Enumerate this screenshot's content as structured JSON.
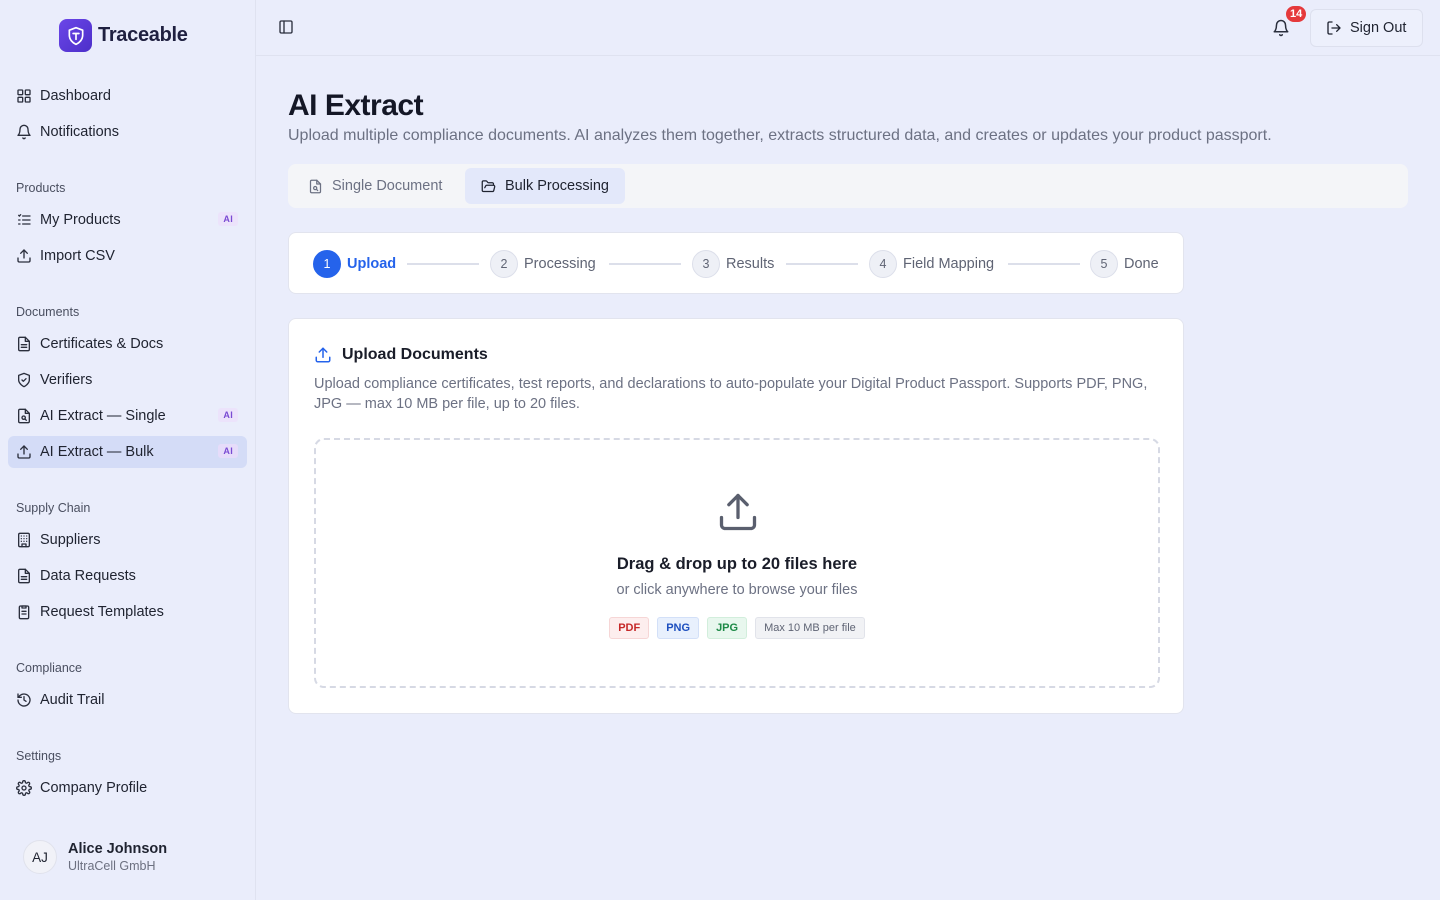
{
  "brand": {
    "name": "Traceable"
  },
  "sidebar": {
    "top_items": [
      {
        "label": "Dashboard",
        "icon": "grid-icon"
      },
      {
        "label": "Notifications",
        "icon": "bell-icon"
      }
    ],
    "sections": [
      {
        "label": "Products",
        "items": [
          {
            "label": "My Products",
            "icon": "list-icon",
            "badge": "AI"
          },
          {
            "label": "Import CSV",
            "icon": "upload-icon"
          }
        ]
      },
      {
        "label": "Documents",
        "items": [
          {
            "label": "Certificates & Docs",
            "icon": "document-icon"
          },
          {
            "label": "Verifiers",
            "icon": "shield-check-icon"
          },
          {
            "label": "AI Extract — Single",
            "icon": "document-scan-icon",
            "badge": "AI"
          },
          {
            "label": "AI Extract — Bulk",
            "icon": "upload-icon",
            "badge": "AI",
            "active": true
          }
        ]
      },
      {
        "label": "Supply Chain",
        "items": [
          {
            "label": "Suppliers",
            "icon": "building-icon"
          },
          {
            "label": "Data Requests",
            "icon": "document-icon"
          },
          {
            "label": "Request Templates",
            "icon": "clipboard-icon"
          }
        ]
      },
      {
        "label": "Compliance",
        "items": [
          {
            "label": "Audit Trail",
            "icon": "history-icon"
          }
        ]
      },
      {
        "label": "Settings",
        "items": [
          {
            "label": "Company Profile",
            "icon": "gear-icon"
          }
        ]
      }
    ],
    "user": {
      "initials": "AJ",
      "name": "Alice Johnson",
      "org": "UltraCell GmbH"
    }
  },
  "topbar": {
    "notification_count": "14",
    "sign_out_label": "Sign Out"
  },
  "main": {
    "title": "AI Extract",
    "subtitle": "Upload multiple compliance documents. AI analyzes them together, extracts structured data, and creates or updates your product passport.",
    "tabs": [
      {
        "label": "Single Document"
      },
      {
        "label": "Bulk Processing",
        "active": true
      }
    ],
    "steps": [
      {
        "num": "1",
        "label": "Upload",
        "active": true
      },
      {
        "num": "2",
        "label": "Processing"
      },
      {
        "num": "3",
        "label": "Results"
      },
      {
        "num": "4",
        "label": "Field Mapping"
      },
      {
        "num": "5",
        "label": "Done"
      }
    ],
    "upload": {
      "title": "Upload Documents",
      "description": "Upload compliance certificates, test reports, and declarations to auto-populate your Digital Product Passport. Supports PDF, PNG, JPG — max 10 MB per file, up to 20 files.",
      "drop_title": "Drag & drop up to 20 files here",
      "drop_subtitle": "or click anywhere to browse your files",
      "pills": [
        "PDF",
        "PNG",
        "JPG",
        "Max 10 MB per file"
      ]
    }
  },
  "colors": {
    "accent": "#2563eb",
    "brand": "#5b3ad9",
    "danger": "#e5393b"
  }
}
